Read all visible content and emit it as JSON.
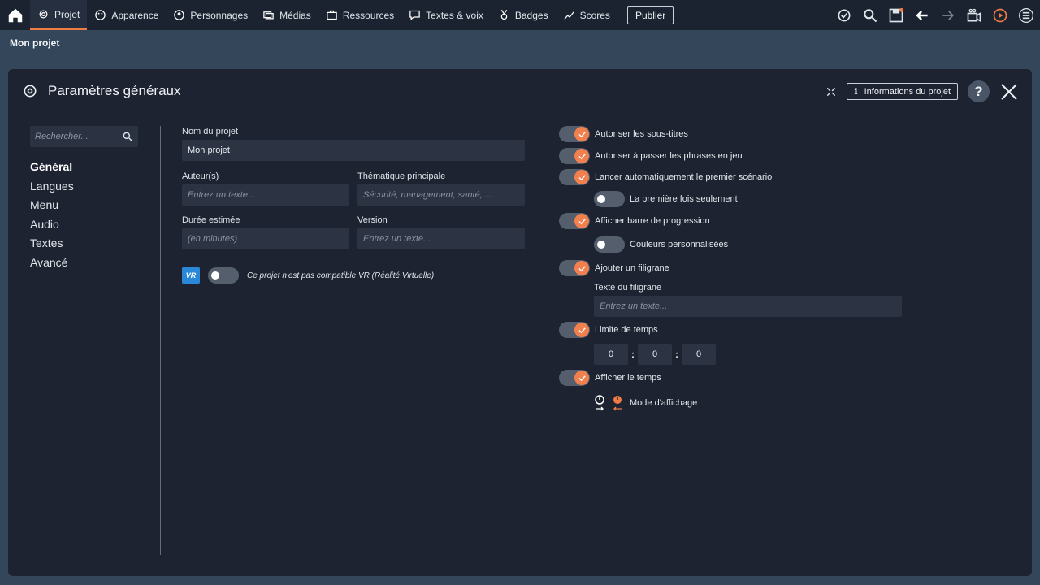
{
  "topnav": {
    "tabs": [
      {
        "label": "Projet",
        "icon": "gear-icon",
        "active": true
      },
      {
        "label": "Apparence",
        "icon": "palette-icon"
      },
      {
        "label": "Personnages",
        "icon": "person-icon"
      },
      {
        "label": "Médias",
        "icon": "media-icon"
      },
      {
        "label": "Ressources",
        "icon": "briefcase-icon"
      },
      {
        "label": "Textes & voix",
        "icon": "speech-icon"
      },
      {
        "label": "Badges",
        "icon": "medal-icon"
      },
      {
        "label": "Scores",
        "icon": "chart-icon"
      }
    ],
    "publish_label": "Publier",
    "accent": "#ef7b45"
  },
  "breadcrumb": "Mon projet",
  "panel": {
    "title": "Paramètres généraux",
    "info_button": "Informations du projet",
    "help": "?"
  },
  "sidebar": {
    "search_placeholder": "Rechercher...",
    "items": [
      "Général",
      "Langues",
      "Menu",
      "Audio",
      "Textes",
      "Avancé"
    ]
  },
  "form": {
    "name_label": "Nom du projet",
    "name_value": "Mon projet",
    "authors_label": "Auteur(s)",
    "authors_placeholder": "Entrez un texte...",
    "theme_label": "Thématique principale",
    "theme_placeholder": "Sécurité, management, santé, ...",
    "duration_label": "Durée estimée",
    "duration_placeholder": "(en minutes)",
    "version_label": "Version",
    "version_placeholder": "Entrez un texte...",
    "vr_badge": "VR",
    "vr_text": "Ce projet n'est pas compatible VR (Réalité Virtuelle)"
  },
  "options": {
    "subtitles": "Autoriser les sous-titres",
    "skip": "Autoriser à passer les phrases en jeu",
    "autostart": "Lancer automatiquement le premier scénario",
    "first_time": "La première fois seulement",
    "progress": "Afficher barre de progression",
    "custom_colors": "Couleurs personnalisées",
    "watermark": "Ajouter un filigrane",
    "watermark_text_label": "Texte du filigrane",
    "watermark_placeholder": "Entrez un texte...",
    "time_limit": "Limite de temps",
    "time_h": "0",
    "time_m": "0",
    "time_s": "0",
    "time_sep": ":",
    "show_time": "Afficher le temps",
    "display_mode": "Mode d'affichage"
  }
}
